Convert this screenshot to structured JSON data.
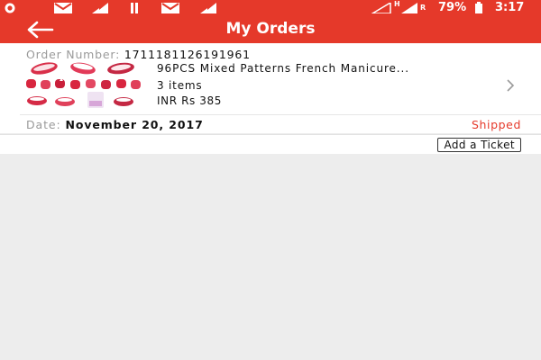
{
  "status_bar": {
    "battery": "79%",
    "time": "3:17",
    "network_badge": "H",
    "roaming_badge": "R",
    "icons": [
      "whatsapp-icon",
      "gmail-icon",
      "download-icon",
      "pause-icon",
      "gmail-icon",
      "download-icon",
      "signal-icon",
      "battery-icon"
    ]
  },
  "app_bar": {
    "title": "My Orders",
    "back_icon": "arrow-left-icon"
  },
  "order": {
    "number_label": "Order Number:",
    "number": "1711181126191961",
    "product_title": "96PCS Mixed Patterns French Manicure...",
    "items": "3 items",
    "price": "INR Rs 385",
    "date_label": "Date:",
    "date": "November 20, 2017",
    "status": "Shipped"
  },
  "actions": {
    "add_ticket": "Add a Ticket"
  },
  "colors": {
    "brand": "#e5392a",
    "status_shipped": "#e5392a",
    "background": "#ededed"
  }
}
